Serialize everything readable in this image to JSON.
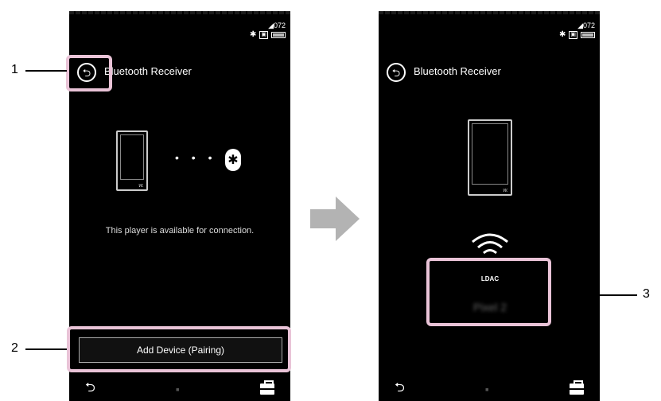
{
  "left_screen": {
    "status": {
      "volume": "◢072"
    },
    "title": "Bluetooth Receiver",
    "message": "This player is available for connection.",
    "pair_button_label": "Add Device (Pairing)",
    "player_logo": "w."
  },
  "right_screen": {
    "status": {
      "volume": "◢072"
    },
    "title": "Bluetooth Receiver",
    "codec": "LDAC",
    "device_name": "Pixel 2",
    "player_logo": "w."
  },
  "callouts": [
    "1",
    "2",
    "3"
  ],
  "icons": {
    "back": "⮌",
    "bluetooth": "✱",
    "dots": "• • •",
    "bottom_back": "⮌",
    "bottom_mid": "▪",
    "toolbox": "toolbox-icon"
  },
  "colors": {
    "highlight": "#e9c3d7",
    "arrow": "#b3b3b3"
  }
}
